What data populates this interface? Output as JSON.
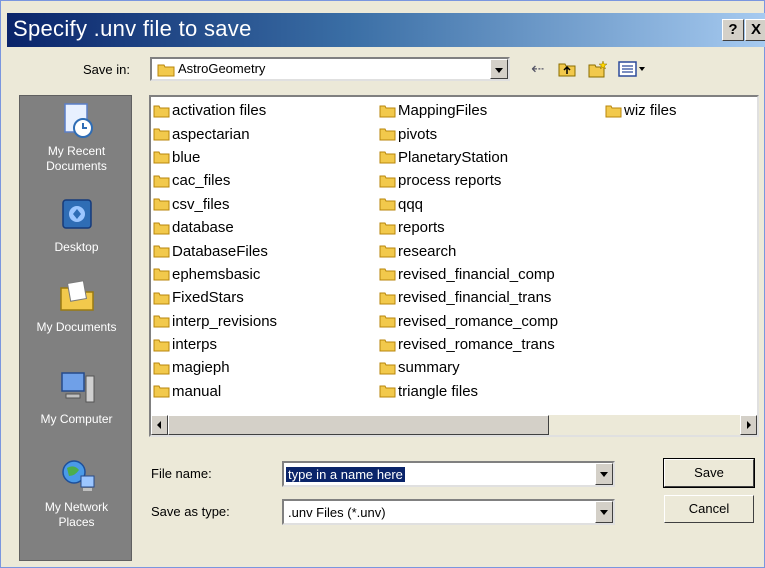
{
  "window": {
    "title": "Specify .unv file to save",
    "help_label": "?",
    "close_label": "X"
  },
  "toolbar": {
    "save_in_label": "Save in:",
    "save_in_value": "AstroGeometry",
    "back_icon": "back-arrow-icon",
    "up_icon": "up-one-level-icon",
    "new_icon": "new-folder-icon",
    "view_icon": "view-menu-icon"
  },
  "places": [
    {
      "label_1": "My Recent",
      "label_2": "Documents",
      "icon": "recent-documents-icon"
    },
    {
      "label_1": "Desktop",
      "label_2": "",
      "icon": "desktop-icon"
    },
    {
      "label_1": "My Documents",
      "label_2": "",
      "icon": "my-documents-icon"
    },
    {
      "label_1": "My Computer",
      "label_2": "",
      "icon": "my-computer-icon"
    },
    {
      "label_1": "My Network",
      "label_2": "Places",
      "icon": "network-places-icon"
    }
  ],
  "files": {
    "col1": [
      "activation files",
      "aspectarian",
      "blue",
      "cac_files",
      "csv_files",
      "database",
      "DatabaseFiles",
      "ephemsbasic",
      "FixedStars",
      "interp_revisions",
      "interps",
      "magieph",
      "manual"
    ],
    "col2": [
      "MappingFiles",
      "pivots",
      "PlanetaryStation",
      "process reports",
      "qqq",
      "reports",
      "research",
      "revised_financial_comp",
      "revised_financial_trans",
      "revised_romance_comp",
      "revised_romance_trans",
      "summary",
      "triangle files"
    ],
    "col3": [
      "wiz files"
    ]
  },
  "form": {
    "file_name_label": "File name:",
    "file_name_value": "type in a name here",
    "save_as_type_label": "Save as type:",
    "save_as_type_value": ".unv Files (*.unv)"
  },
  "buttons": {
    "save": "Save",
    "cancel": "Cancel"
  },
  "colors": {
    "titlebar": "#0a246a",
    "places_bg": "#808080",
    "folder": "#f2c94c",
    "dialog_bg": "#ece9d8"
  }
}
